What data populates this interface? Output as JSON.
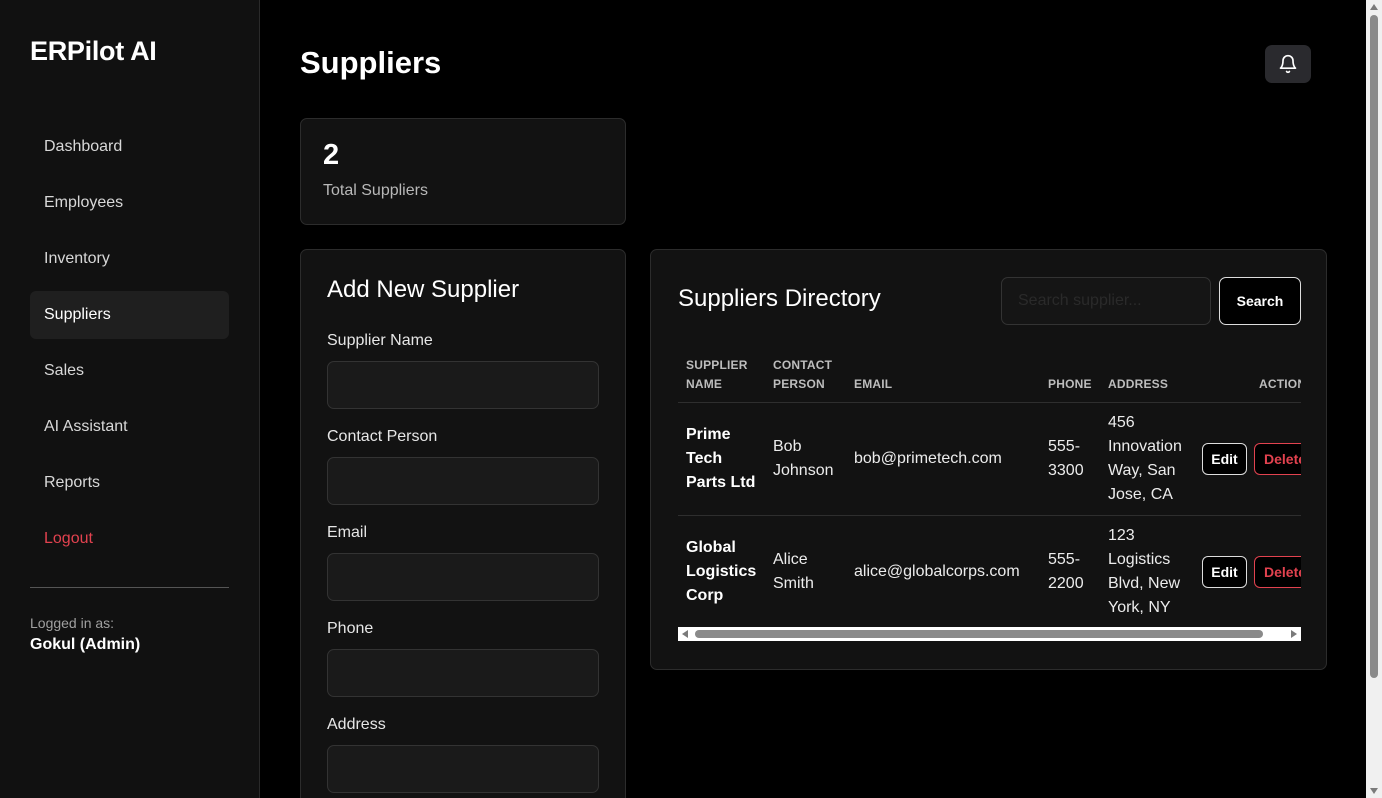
{
  "app": {
    "brand": "ERPilot AI"
  },
  "sidebar": {
    "items": [
      {
        "label": "Dashboard"
      },
      {
        "label": "Employees"
      },
      {
        "label": "Inventory"
      },
      {
        "label": "Suppliers"
      },
      {
        "label": "Sales"
      },
      {
        "label": "AI Assistant"
      },
      {
        "label": "Reports"
      },
      {
        "label": "Logout"
      }
    ],
    "active": "Suppliers",
    "logged_in_label": "Logged in as:",
    "user": "Gokul (Admin)"
  },
  "header": {
    "title": "Suppliers",
    "notification_icon": "bell-icon"
  },
  "stats": {
    "value": "2",
    "label": "Total Suppliers"
  },
  "form": {
    "title": "Add New Supplier",
    "fields": [
      {
        "label": "Supplier Name",
        "value": ""
      },
      {
        "label": "Contact Person",
        "value": ""
      },
      {
        "label": "Email",
        "value": ""
      },
      {
        "label": "Phone",
        "value": ""
      },
      {
        "label": "Address",
        "value": ""
      }
    ]
  },
  "directory": {
    "title": "Suppliers Directory",
    "search_placeholder": "Search supplier...",
    "search_label": "Search",
    "columns": {
      "name": [
        "SUPPLIER",
        "NAME"
      ],
      "contact": [
        "CONTACT",
        "PERSON"
      ],
      "email": "EMAIL",
      "phone": "PHONE",
      "address": "ADDRESS",
      "actions": "ACTIONS"
    },
    "rows": [
      {
        "name": [
          "Prime",
          "Tech",
          "Parts Ltd"
        ],
        "contact": [
          "Bob",
          "Johnson"
        ],
        "email": "bob@primetech.com",
        "phone": [
          "555-",
          "3300"
        ],
        "address": [
          "456",
          "Innovation",
          "Way, San",
          "Jose, CA"
        ],
        "edit": "Edit",
        "delete": "Delete"
      },
      {
        "name": [
          "Global",
          "Logistics",
          "Corp"
        ],
        "contact": [
          "Alice",
          "Smith"
        ],
        "email": "alice@globalcorps.com",
        "phone": [
          "555-",
          "2200"
        ],
        "address": [
          "123",
          "Logistics",
          "Blvd, New",
          "York, NY"
        ],
        "edit": "Edit",
        "delete": "Delete"
      }
    ]
  },
  "colors": {
    "accent_danger": "#e2424f",
    "bg": "#000000",
    "card": "#121212",
    "sidebar": "#111111"
  }
}
